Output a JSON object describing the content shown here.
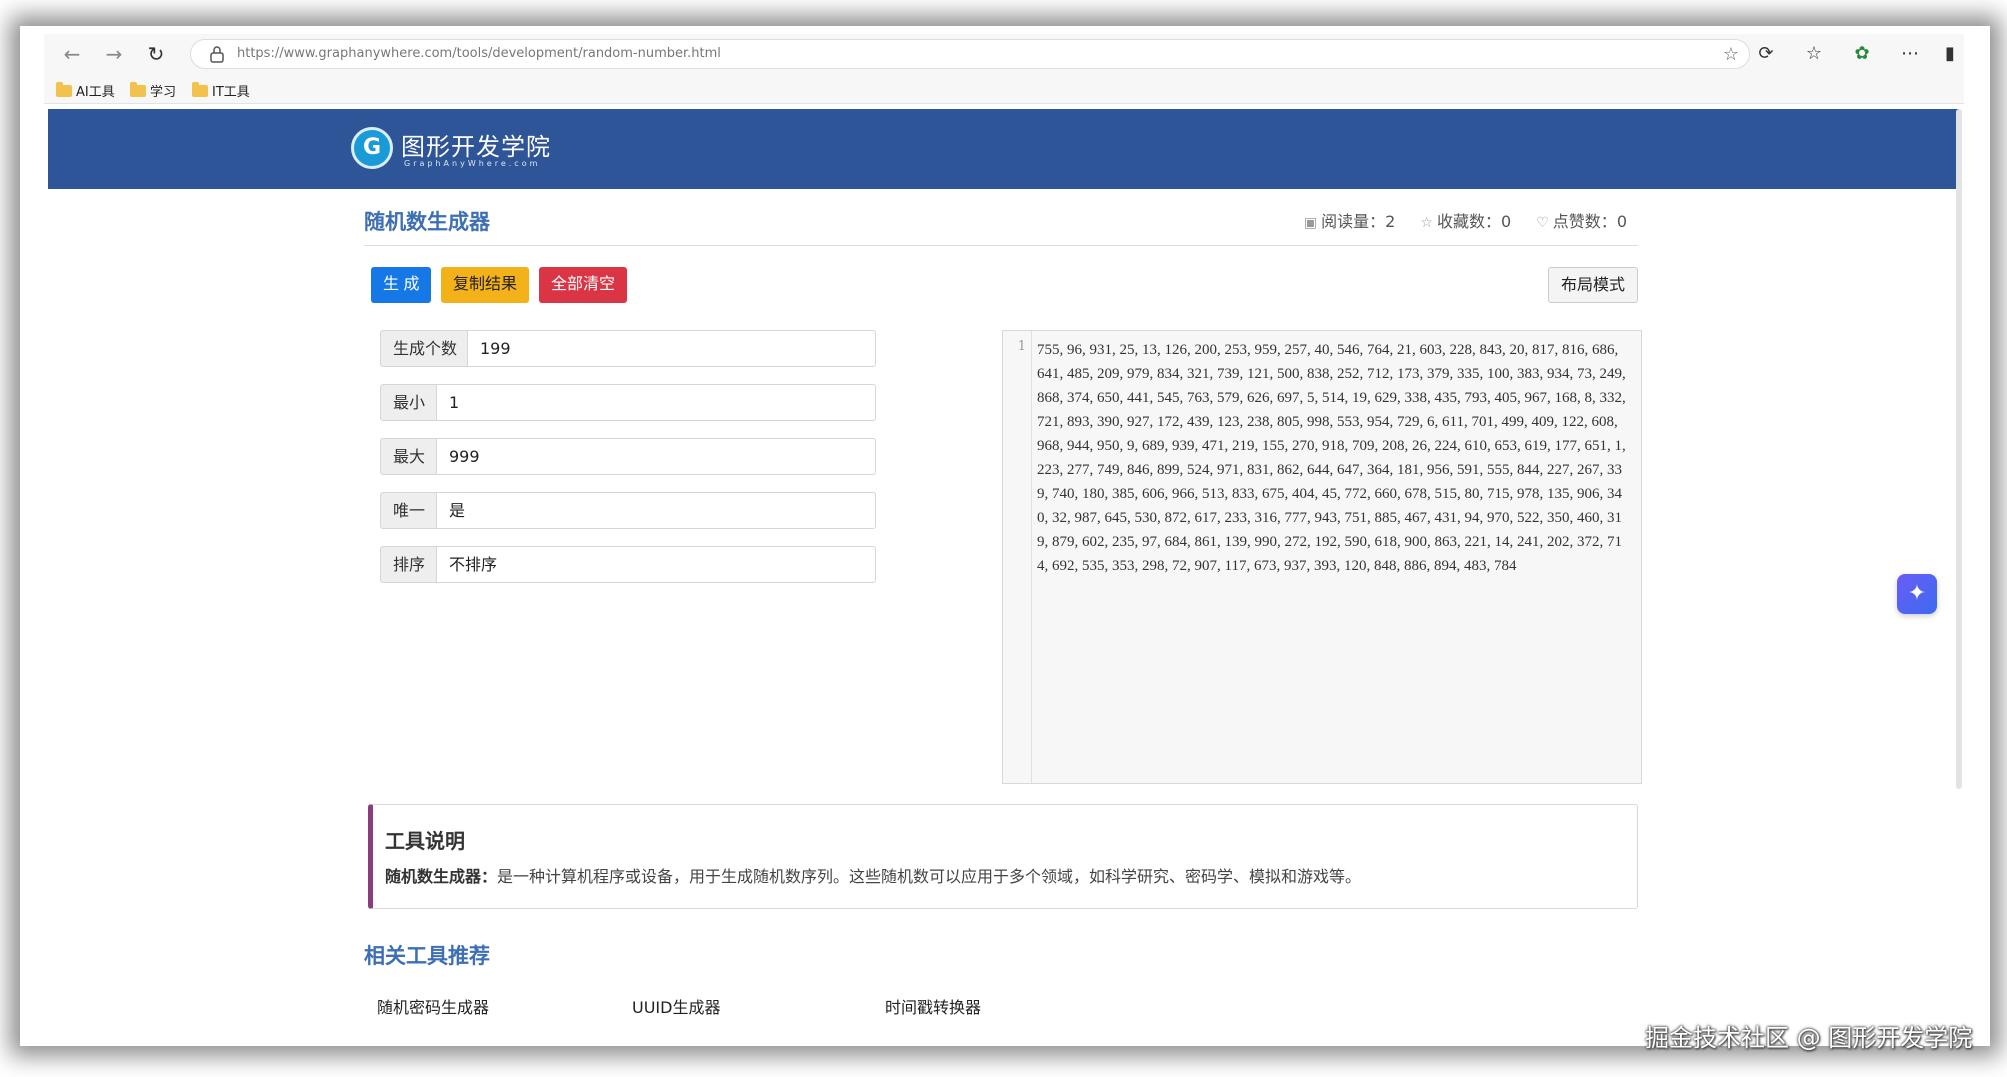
{
  "browser": {
    "url_host": "https://www.graphanywhere.com",
    "url_path": "/tools/development/random-number.html",
    "bookmarks": [
      "AI工具",
      "学习",
      "IT工具"
    ]
  },
  "site": {
    "name": "图形开发学院",
    "tagline": "GraphAnyWhere.com"
  },
  "page": {
    "title": "随机数生成器",
    "stats": {
      "views_label": "阅读量：",
      "views": "2",
      "favorites_label": "收藏数：",
      "favorites": "0",
      "likes_label": "点赞数：",
      "likes": "0"
    }
  },
  "toolbar": {
    "generate": "生 成",
    "copy": "复制结果",
    "clear": "全部清空",
    "layout": "布局模式"
  },
  "form": [
    {
      "label": "生成个数",
      "value": "199"
    },
    {
      "label": "最小",
      "value": "1"
    },
    {
      "label": "最大",
      "value": "999"
    },
    {
      "label": "唯一",
      "value": "是"
    },
    {
      "label": "排序",
      "value": "不排序"
    }
  ],
  "editor": {
    "line_number": "1",
    "content": "755, 96, 931, 25, 13, 126, 200, 253, 959, 257, 40, 546, 764, 21, 603, 228, 843, 20, 817, 816, 686, 641, 485, 209, 979, 834, 321, 739, 121, 500, 838, 252, 712, 173, 379, 335, 100, 383, 934, 73, 249, 868, 374, 650, 441, 545, 763, 579, 626, 697, 5, 514, 19, 629, 338, 435, 793, 405, 967, 168, 8, 332, 721, 893, 390, 927, 172, 439, 123, 238, 805, 998, 553, 954, 729, 6, 611, 701, 499, 409, 122, 608, 968, 944, 950, 9, 689, 939, 471, 219, 155, 270, 918, 709, 208, 26, 224, 610, 653, 619, 177, 651, 1, 223, 277, 749, 846, 899, 524, 971, 831, 862, 644, 647, 364, 181, 956, 591, 555, 844, 227, 267, 339, 740, 180, 385, 606, 966, 513, 833, 675, 404, 45, 772, 660, 678, 515, 80, 715, 978, 135, 906, 340, 32, 987, 645, 530, 872, 617, 233, 316, 777, 943, 751, 885, 467, 431, 94, 970, 522, 350, 460, 319, 879, 602, 235, 97, 684, 861, 139, 990, 272, 192, 590, 618, 900, 863, 221, 14, 241, 202, 372, 714, 692, 535, 353, 298, 72, 907, 117, 673, 937, 393, 120, 848, 886, 894, 483, 784"
  },
  "description": {
    "title": "工具说明",
    "term": "随机数生成器：",
    "text": "是一种计算机程序或设备，用于生成随机数序列。这些随机数可以应用于多个领域，如科学研究、密码学、模拟和游戏等。"
  },
  "related": {
    "title": "相关工具推荐",
    "links": [
      "随机密码生成器",
      "UUID生成器",
      "时间戳转换器"
    ]
  },
  "watermark": "掘金技术社区 @ 图形开发学院",
  "colors": {
    "header": "#2e5597",
    "accent": "#3d6fb2",
    "primary": "#1677e6",
    "warning": "#f3b11a",
    "danger": "#d93545",
    "desc_border": "#8a3d7a"
  }
}
